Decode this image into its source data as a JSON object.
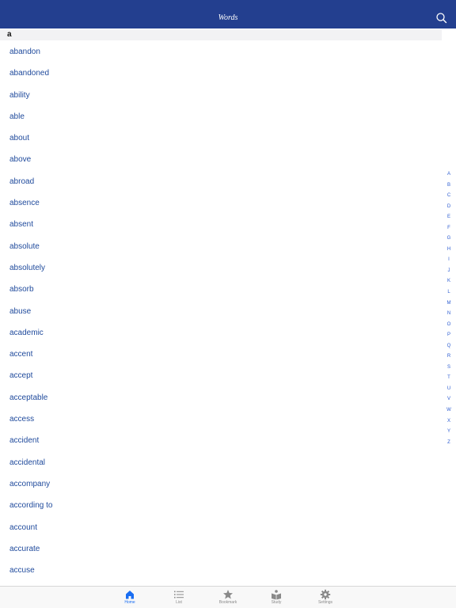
{
  "navbar": {
    "title": "Words",
    "search_icon": "search-icon"
  },
  "section": {
    "header": "a"
  },
  "words": [
    "abandon",
    "abandoned",
    "ability",
    "able",
    "about",
    "above",
    "abroad",
    "absence",
    "absent",
    "absolute",
    "absolutely",
    "absorb",
    "abuse",
    "academic",
    "accent",
    "accept",
    "acceptable",
    "access",
    "accident",
    "accidental",
    "accompany",
    "according to",
    "account",
    "accurate",
    "accuse"
  ],
  "index_letters": [
    "A",
    "B",
    "C",
    "D",
    "E",
    "F",
    "G",
    "H",
    "I",
    "J",
    "K",
    "L",
    "M",
    "N",
    "O",
    "P",
    "Q",
    "R",
    "S",
    "T",
    "U",
    "V",
    "W",
    "X",
    "Y",
    "Z"
  ],
  "tabs": [
    {
      "label": "Home",
      "icon": "home-icon",
      "active": true
    },
    {
      "label": "List",
      "icon": "list-icon",
      "active": false
    },
    {
      "label": "Bookmark",
      "icon": "star-icon",
      "active": false
    },
    {
      "label": "Study",
      "icon": "study-icon",
      "active": false
    },
    {
      "label": "Settings",
      "icon": "gear-icon",
      "active": false
    }
  ],
  "colors": {
    "navbar_bg": "#233f8f",
    "word_text": "#1f4a9c",
    "index_text": "#2b5bd0",
    "tab_active": "#1a6ef2",
    "tab_inactive": "#8a8a8a"
  }
}
